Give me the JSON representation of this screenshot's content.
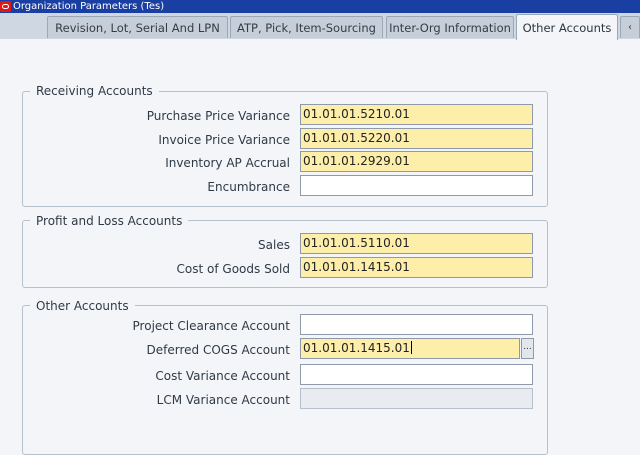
{
  "window": {
    "title": "Organization Parameters (Tes)"
  },
  "tabs": [
    {
      "label": "Revision, Lot, Serial And LPN"
    },
    {
      "label": "ATP, Pick, Item-Sourcing"
    },
    {
      "label": "Inter-Org Information"
    },
    {
      "label": "Other Accounts"
    }
  ],
  "tab_scroll": {
    "icon": "arrow-left-icon",
    "glyph": "‹"
  },
  "receiving": {
    "title": "Receiving Accounts",
    "fields": [
      {
        "label": "Purchase Price Variance",
        "value": "01.01.01.5210.01"
      },
      {
        "label": "Invoice Price Variance",
        "value": "01.01.01.5220.01"
      },
      {
        "label": "Inventory AP Accrual",
        "value": "01.01.01.2929.01"
      },
      {
        "label": "Encumbrance",
        "value": ""
      }
    ]
  },
  "profit_loss": {
    "title": "Profit and Loss Accounts",
    "fields": [
      {
        "label": "Sales",
        "value": "01.01.01.5110.01"
      },
      {
        "label": "Cost of Goods Sold",
        "value": "01.01.01.1415.01"
      }
    ]
  },
  "other": {
    "title": "Other Accounts",
    "fields": [
      {
        "label": "Project Clearance Account",
        "value": ""
      },
      {
        "label": "Deferred COGS Account",
        "value": "01.01.01.1415.01"
      },
      {
        "label": "Cost Variance Account",
        "value": ""
      },
      {
        "label": "LCM Variance Account",
        "value": ""
      }
    ],
    "lov_button": "..."
  }
}
